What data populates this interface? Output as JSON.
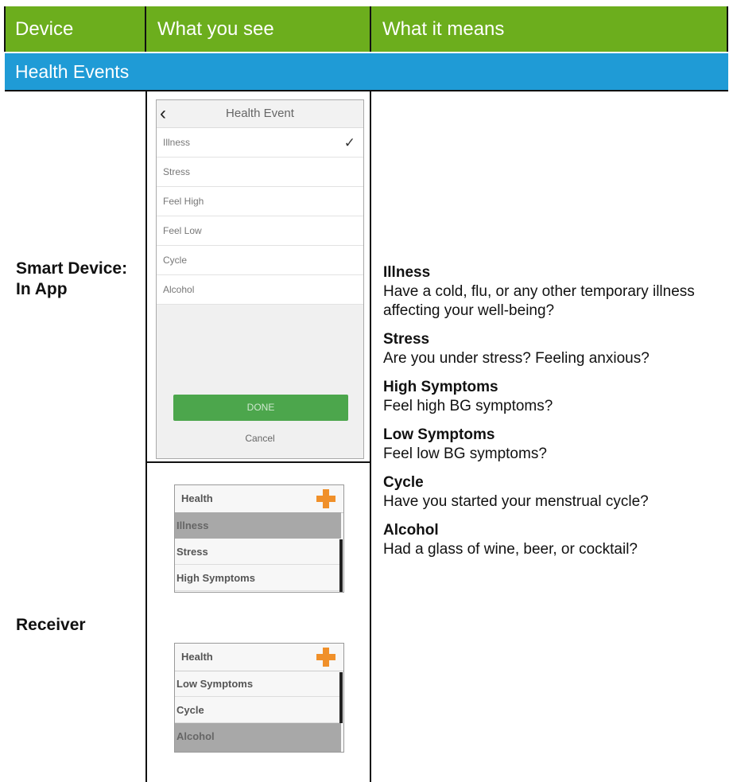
{
  "header": {
    "col_device": "Device",
    "col_see": "What you see",
    "col_means": "What it means"
  },
  "section_title": "Health Events",
  "colors": {
    "header_bg": "#6cae1d",
    "section_bg": "#1f9bd6",
    "done_button": "#4ca64c",
    "plus_icon": "#f0902a"
  },
  "rows": {
    "smart_device_label": "Smart Device:\nIn App",
    "receiver_label": "Receiver"
  },
  "phone": {
    "title": "Health Event",
    "items": [
      "Illness",
      "Stress",
      "Feel High",
      "Feel Low",
      "Cycle",
      "Alcohol"
    ],
    "checked_item": "Illness",
    "done_label": "DONE",
    "cancel_label": "Cancel"
  },
  "receiver_screen_1": {
    "title": "Health",
    "items": [
      "Illness",
      "Stress",
      "High Symptoms"
    ],
    "selected_item": "Illness"
  },
  "receiver_screen_2": {
    "title": "Health",
    "items": [
      "Low Symptoms",
      "Cycle",
      "Alcohol"
    ],
    "selected_item": "Alcohol"
  },
  "meanings": [
    {
      "title": "Illness",
      "desc": "Have a cold, flu, or any other temporary illness affecting your well-being?"
    },
    {
      "title": "Stress",
      "desc": "Are you under stress? Feeling anxious?"
    },
    {
      "title": "High Symptoms",
      "desc": "Feel high BG symptoms?"
    },
    {
      "title": "Low Symptoms",
      "desc": "Feel low BG symptoms?"
    },
    {
      "title": "Cycle",
      "desc": "Have you started your menstrual cycle?"
    },
    {
      "title": "Alcohol",
      "desc": "Had a glass of wine, beer, or cocktail?"
    }
  ]
}
